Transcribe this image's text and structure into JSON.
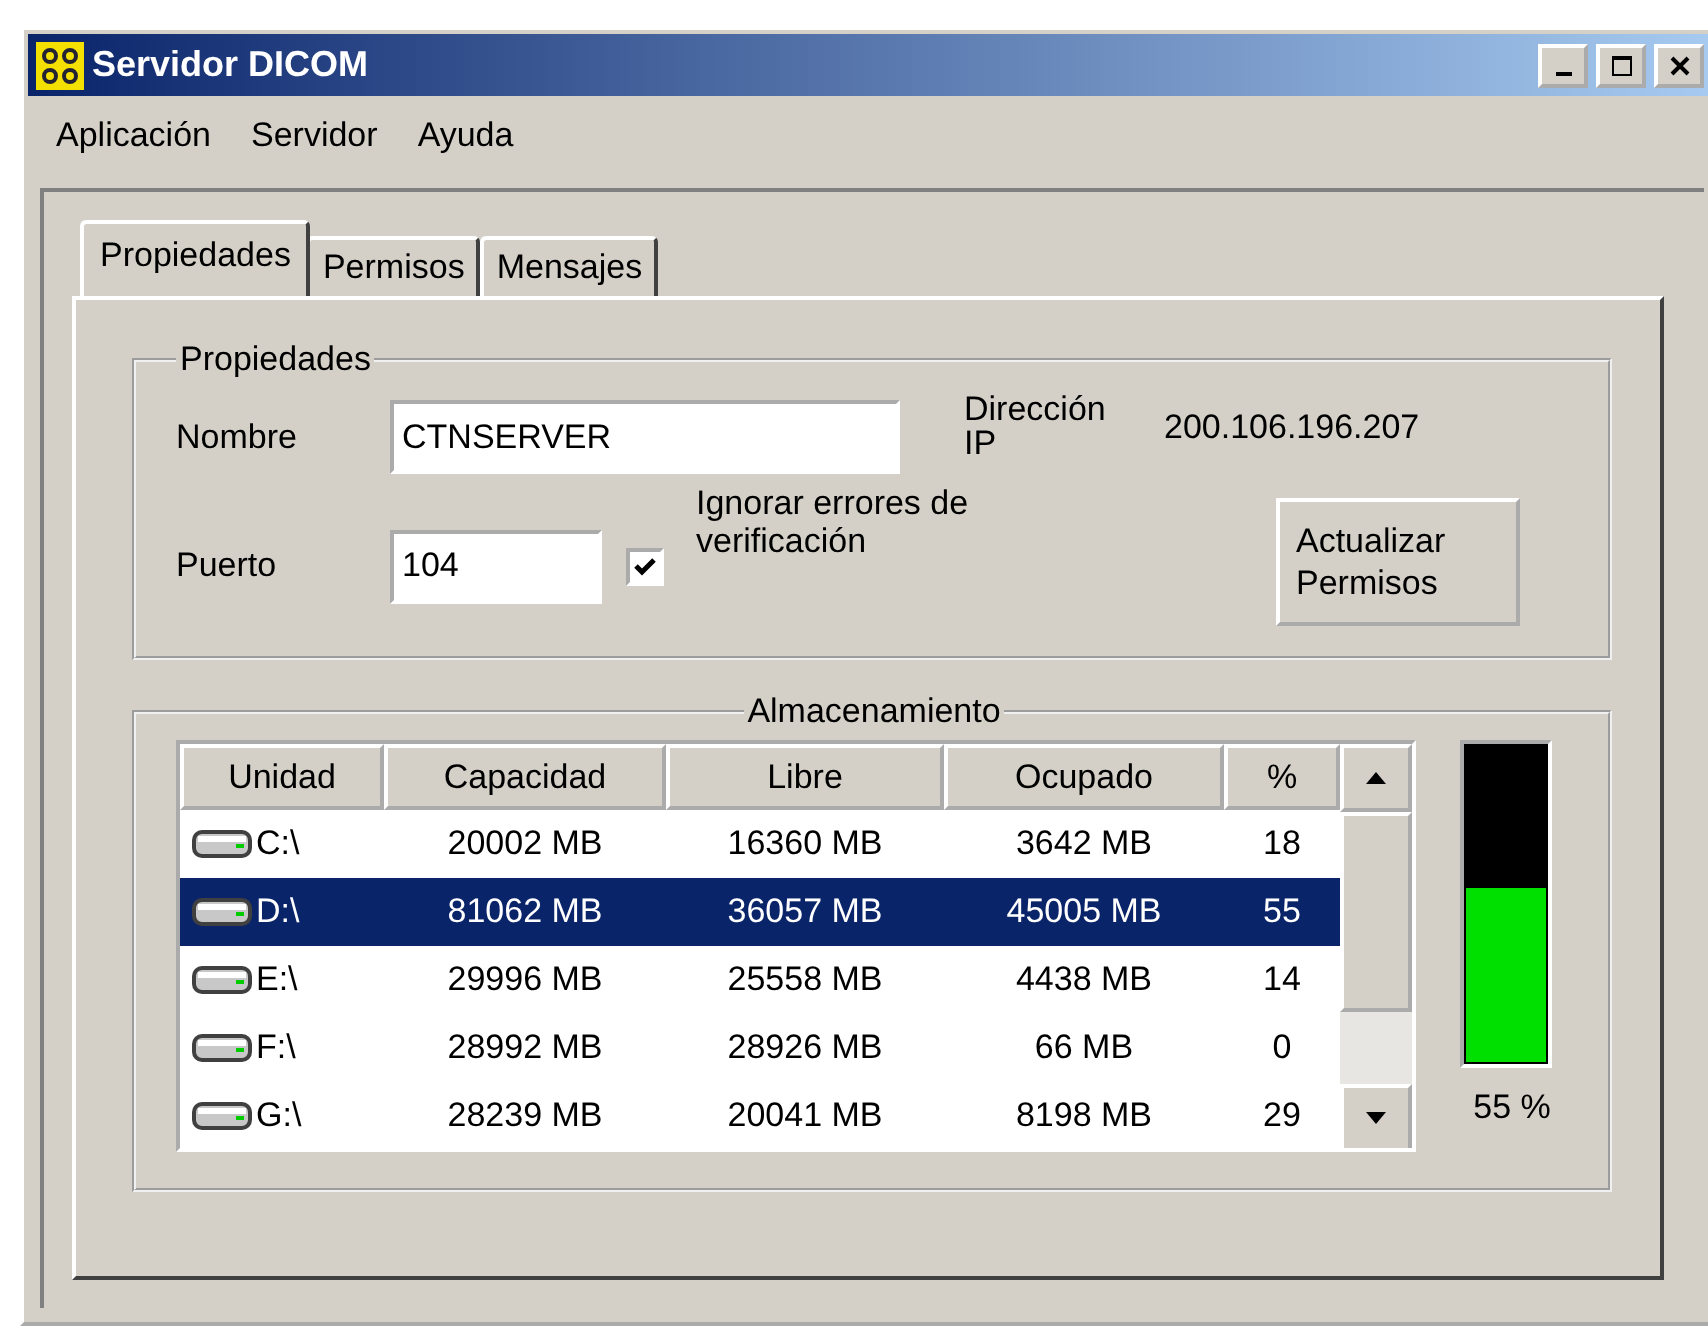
{
  "window": {
    "title": "Servidor DICOM"
  },
  "menu": [
    "Aplicación",
    "Servidor",
    "Ayuda"
  ],
  "tabs": [
    {
      "label": "Propiedades",
      "selected": true
    },
    {
      "label": "Permisos",
      "selected": false
    },
    {
      "label": "Mensajes",
      "selected": false
    }
  ],
  "properties": {
    "title": "Propiedades",
    "name_label": "Nombre",
    "name_value": "CTNSERVER",
    "ip_label": "Dirección IP",
    "ip_value": "200.106.196.207",
    "port_label": "Puerto",
    "port_value": "104",
    "ignore_errors": {
      "label": "Ignorar errores de verificación",
      "checked": true
    },
    "update_button": "Actualizar Permisos"
  },
  "storage": {
    "title": "Almacenamiento",
    "columns": [
      "Unidad",
      "Capacidad",
      "Libre",
      "Ocupado",
      "%"
    ],
    "rows": [
      {
        "cells": [
          "C:\\",
          "20002 MB",
          "16360 MB",
          "3642 MB",
          "18"
        ],
        "selected": false
      },
      {
        "cells": [
          "D:\\",
          "81062 MB",
          "36057 MB",
          "45005 MB",
          "55"
        ],
        "selected": true
      },
      {
        "cells": [
          "E:\\",
          "29996 MB",
          "25558 MB",
          "4438 MB",
          "14"
        ],
        "selected": false
      },
      {
        "cells": [
          "F:\\",
          "28992 MB",
          "28926 MB",
          "66 MB",
          "0"
        ],
        "selected": false
      },
      {
        "cells": [
          "G:\\",
          "28239 MB",
          "20041 MB",
          "8198 MB",
          "29"
        ],
        "selected": false
      }
    ],
    "usage": {
      "level": 0.55,
      "reading": "55 %"
    }
  }
}
